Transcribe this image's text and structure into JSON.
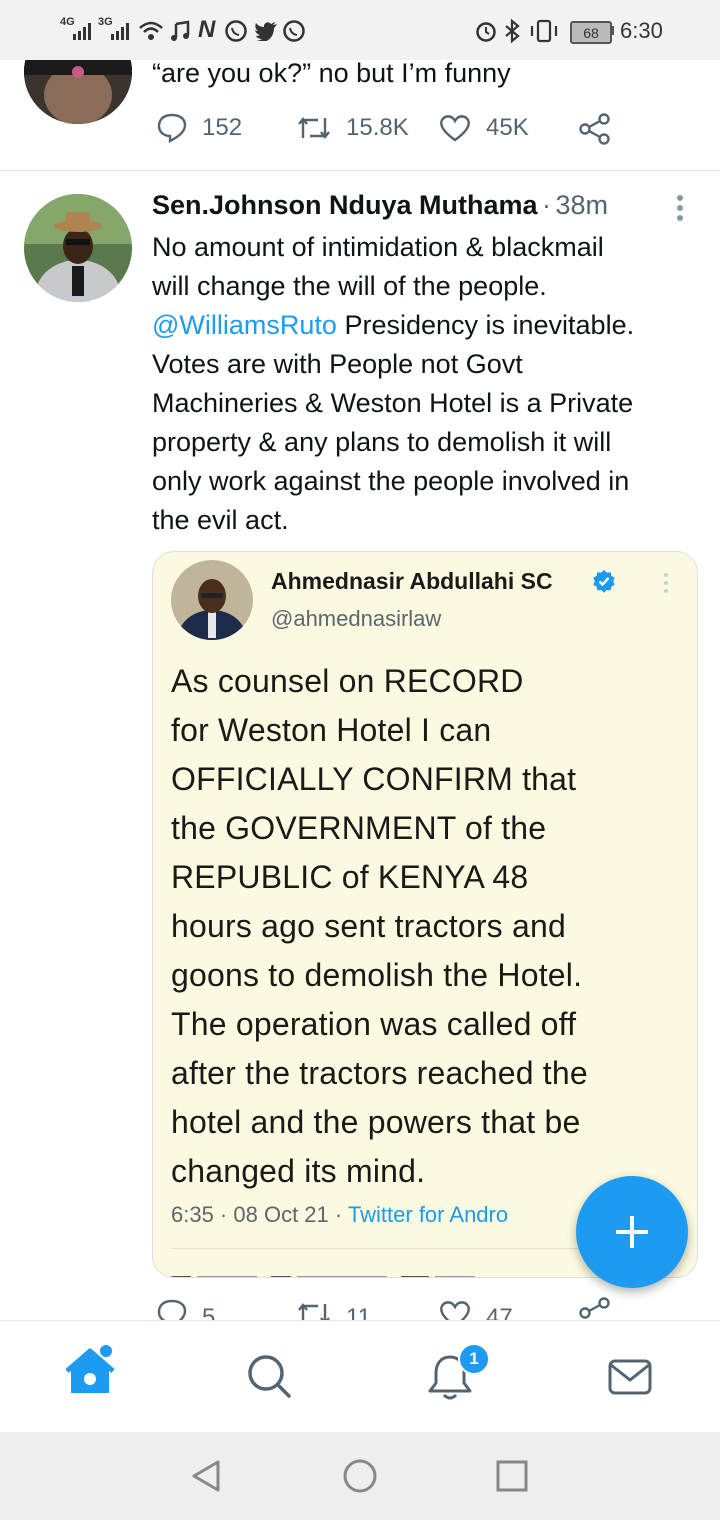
{
  "status_bar": {
    "signal_1_label": "4G",
    "signal_2_label": "3G",
    "icons_left": [
      "signal-icon",
      "signal-icon",
      "wifi-icon",
      "music-icon",
      "netflix-icon",
      "whatsapp-icon",
      "twitter-icon",
      "whatsapp-icon"
    ],
    "icons_right": [
      "alarm-icon",
      "bluetooth-icon",
      "vibrate-icon",
      "battery-icon"
    ],
    "battery": "68",
    "time": "6:30"
  },
  "previous_tweet": {
    "text": "“are you ok?” no but I’m funny",
    "replies": "152",
    "retweets": "15.8K",
    "likes": "45K"
  },
  "tweet": {
    "author_name": "Sen.Johnson Nduya Muthama",
    "separator": "·",
    "time_ago": "38m",
    "text_line_1": "No amount of intimidation & blackmail",
    "text_line_2": "will change the will of the people.",
    "mention": "@WilliamsRuto",
    "text_line_3_rest": " Presidency is inevitable.",
    "text_line_4": "Votes are with People not Govt",
    "text_line_5": "Machineries & Weston Hotel is a Private",
    "text_line_6": "property & any plans to demolish it will",
    "text_line_7": "only work against the people involved in",
    "text_line_8": "the evil act.",
    "replies": "5",
    "retweets": "11",
    "likes": "47"
  },
  "quoted": {
    "name": "Ahmednasir Abdullahi SC",
    "handle": "@ahmednasirlaw",
    "lines": [
      "As counsel on RECORD",
      "for Weston Hotel I can",
      "OFFICIALLY CONFIRM that",
      "the GOVERNMENT of the",
      "REPUBLIC of KENYA 48",
      "hours ago sent tractors and",
      "goons to demolish the Hotel.",
      "The operation was called off",
      "after the tractors reached the",
      "hotel and the powers that be",
      "changed its mind."
    ],
    "footer_time": "6:35 · 08 Oct 21 · ",
    "footer_source": "Twitter for Andro"
  },
  "bottom_nav": {
    "notifications_badge": "1"
  },
  "colors": {
    "accent": "#1d9bf0",
    "quote_bg": "#fbf9df",
    "muted": "#536471"
  }
}
